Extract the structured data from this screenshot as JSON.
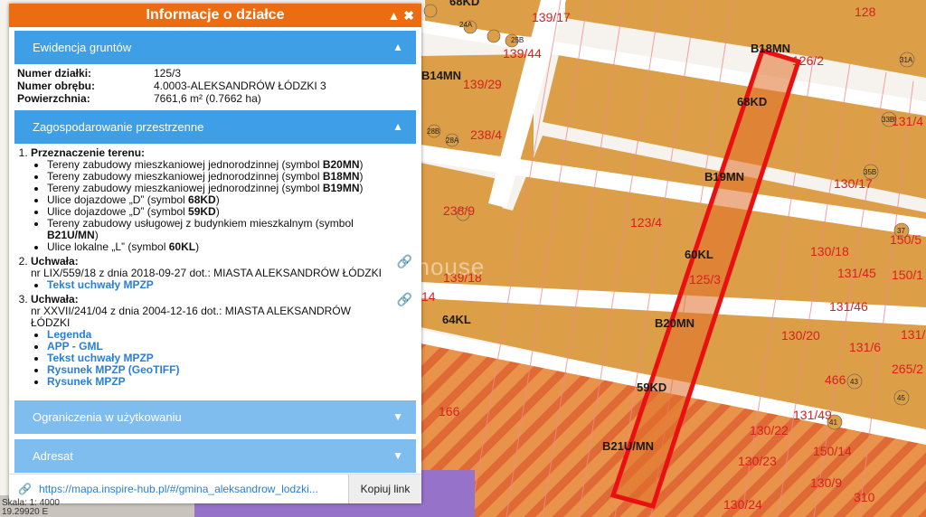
{
  "panel": {
    "title": "Informacje o działce",
    "sections": {
      "ewidencja": "Ewidencja gruntów",
      "zagospodarowanie": "Zagospodarowanie przestrzenne",
      "ograniczenia": "Ograniczenia w użytkowaniu",
      "adresat": "Adresat"
    },
    "ewidencja": {
      "nr_dzialki_label": "Numer działki:",
      "nr_dzialki": "125/3",
      "nr_obrebu_label": "Numer obrębu:",
      "nr_obrebu": "4.0003-ALEKSANDRÓW ŁÓDZKI 3",
      "powierzchnia_label": "Powierzchnia:",
      "powierzchnia": "7661,6 m² (0.7662 ha)"
    },
    "plan": {
      "item1_title": "Przeznaczenie terenu:",
      "uses": [
        {
          "text": "Tereny zabudowy mieszkaniowej jednorodzinnej (symbol ",
          "sym": "B20MN",
          "end": ")"
        },
        {
          "text": "Tereny zabudowy mieszkaniowej jednorodzinnej (symbol ",
          "sym": "B18MN",
          "end": ")"
        },
        {
          "text": "Tereny zabudowy mieszkaniowej jednorodzinnej (symbol ",
          "sym": "B19MN",
          "end": ")"
        },
        {
          "text": "Ulice dojazdowe „D” (symbol ",
          "sym": "68KD",
          "end": ")"
        },
        {
          "text": "Ulice dojazdowe „D” (symbol ",
          "sym": "59KD",
          "end": ")"
        },
        {
          "text": "Tereny zabudowy usługowej z budynkiem mieszkalnym (symbol ",
          "sym": "B21U/MN",
          "end": ")"
        },
        {
          "text": "Ulice lokalne „L” (symbol ",
          "sym": "60KL",
          "end": ")"
        }
      ],
      "item2_title": "Uchwała:",
      "item2_text": "nr LIX/559/18 z dnia 2018-09-27 dot.: MIASTA ALEKSANDRÓW ŁÓDZKI",
      "item2_links": [
        "Tekst uchwały MPZP"
      ],
      "item3_title": "Uchwała:",
      "item3_text": "nr XXVII/241/04 z dnia 2004-12-16 dot.: MIASTA ALEKSANDRÓW ŁÓDZKI",
      "item3_links": [
        "Legenda",
        "APP - GML",
        "Tekst uchwały MPZP",
        "Rysunek MPZP (GeoTIFF)",
        "Rysunek MPZP"
      ]
    },
    "link_url": "https://mapa.inspire-hub.pl/#/gmina_aleksandrow_lodzki...",
    "copy_label": "Kopiuj link"
  },
  "map": {
    "labels": {
      "b18mn": "B18MN",
      "b14mn": "B14MN",
      "b19mn": "B19MN",
      "b20mn": "B20MN",
      "b21umn": "B21U/MN",
      "kd68": "68KD",
      "kl60": "60KL",
      "kl64": "64KL",
      "kd59": "59KD",
      "kd68top": "68KD",
      "p139_17": "139/17",
      "p139_44": "139/44",
      "p139_29": "139/29",
      "p126_2": "126/2",
      "p128": "128",
      "p238_4": "238/4",
      "p238_9": "238/9",
      "p123_4": "123/4",
      "p125_3": "125/3",
      "p139_18": "139/18",
      "p130_17": "130/17",
      "p130_18": "130/18",
      "p131_45": "131/45",
      "p131_46": "131/46",
      "p130_20": "130/20",
      "p131_6": "131/6",
      "p131_49": "131/49",
      "p130_22": "130/22",
      "p150_14": "150/14",
      "p130_23": "130/23",
      "p130_24": "130/24",
      "p166": "166",
      "p310": "310",
      "p466": "466",
      "p131_4": "131/4",
      "p150_5": "150/5",
      "p150_1": "150/1",
      "p14": "14",
      "p265_2": "265/2",
      "p131_": "131/",
      "p130_9": "130/9"
    },
    "watermark": "mateo house",
    "scale_text": "Skala: 1: 4000",
    "coords_text": "19.29920 E"
  },
  "colors": {
    "orange_header": "#ec6d11",
    "section_blue": "#3f9fe6",
    "link_blue": "#2a7fd4",
    "zone_fill": "#dd9e48",
    "parcel_red": "#e81010"
  }
}
